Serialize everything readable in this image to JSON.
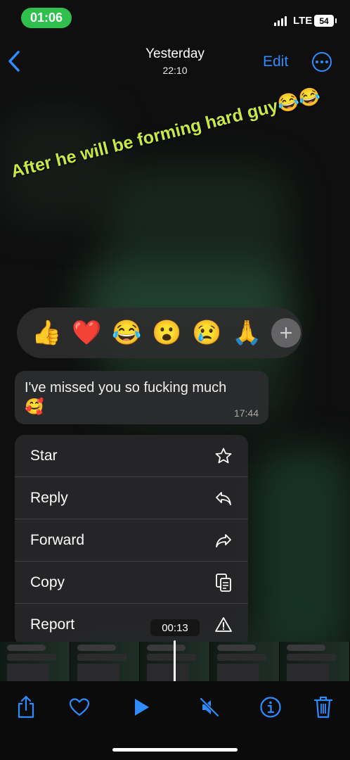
{
  "status_bar": {
    "time": "01:06",
    "network": "LTE",
    "battery": "54"
  },
  "nav": {
    "title": "Yesterday",
    "subtitle": "22:10",
    "edit_label": "Edit",
    "back_icon": "chevron-left-icon",
    "more_icon": "ellipsis-circle-icon"
  },
  "overlay_text": "After he will be forming hard guy😂😂",
  "reactions": {
    "items": [
      "👍",
      "❤️",
      "😂",
      "😮",
      "😢",
      "🙏"
    ],
    "add_icon": "plus-icon"
  },
  "message": {
    "text": "I've missed you so fucking much",
    "emoji": "🥰",
    "time": "17:44"
  },
  "menu": {
    "items": [
      {
        "label": "Star",
        "icon": "star-icon"
      },
      {
        "label": "Reply",
        "icon": "reply-icon"
      },
      {
        "label": "Forward",
        "icon": "forward-icon"
      },
      {
        "label": "Copy",
        "icon": "copy-icon"
      },
      {
        "label": "Report",
        "icon": "warning-icon"
      }
    ]
  },
  "video": {
    "timecode": "00:13"
  },
  "toolbar": {
    "icons": [
      "share-icon",
      "heart-icon",
      "play-icon",
      "speaker-muted-icon",
      "info-icon",
      "trash-icon"
    ]
  },
  "colors": {
    "accent": "#2f8cff",
    "status_pill": "#2fbf4d",
    "overlay_text": "#c9e845"
  }
}
